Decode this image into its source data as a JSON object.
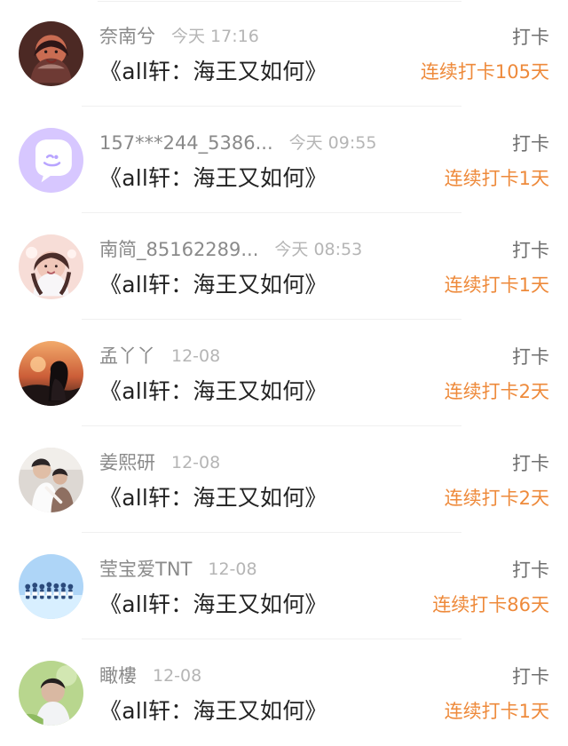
{
  "feed": {
    "items": [
      {
        "name": "奈南兮",
        "time": "今天 17:16",
        "title": "《all轩：海王又如何》",
        "action": "打卡",
        "streak": "连续打卡105天",
        "avatar": "woman-portrait-avatar"
      },
      {
        "name": "157***244_5386...",
        "time": "今天 09:55",
        "title": "《all轩：海王又如何》",
        "action": "打卡",
        "streak": "连续打卡1天",
        "avatar": "chat-bubble-avatar"
      },
      {
        "name": "南简_85162289...",
        "time": "今天 08:53",
        "title": "《all轩：海王又如何》",
        "action": "打卡",
        "streak": "连续打卡1天",
        "avatar": "girl-portrait-avatar"
      },
      {
        "name": "孟丫丫",
        "time": "12-08",
        "title": "《all轩：海王又如何》",
        "action": "打卡",
        "streak": "连续打卡2天",
        "avatar": "sunset-portrait-avatar"
      },
      {
        "name": "姜熙研",
        "time": "12-08",
        "title": "《all轩：海王又如何》",
        "action": "打卡",
        "streak": "连续打卡2天",
        "avatar": "couple-portrait-avatar"
      },
      {
        "name": "莹宝爱TNT",
        "time": "12-08",
        "title": "《all轩：海王又如何》",
        "action": "打卡",
        "streak": "连续打卡86天",
        "avatar": "group-photo-avatar"
      },
      {
        "name": "瞰樓",
        "time": "12-08",
        "title": "《all轩：海王又如何》",
        "action": "打卡",
        "streak": "连续打卡1天",
        "avatar": "boy-portrait-avatar"
      }
    ]
  },
  "colors": {
    "streak_orange": "#ee8a3b",
    "name_gray": "#8a8a8a",
    "time_gray": "#b5b5b5",
    "title_black": "#222222"
  }
}
